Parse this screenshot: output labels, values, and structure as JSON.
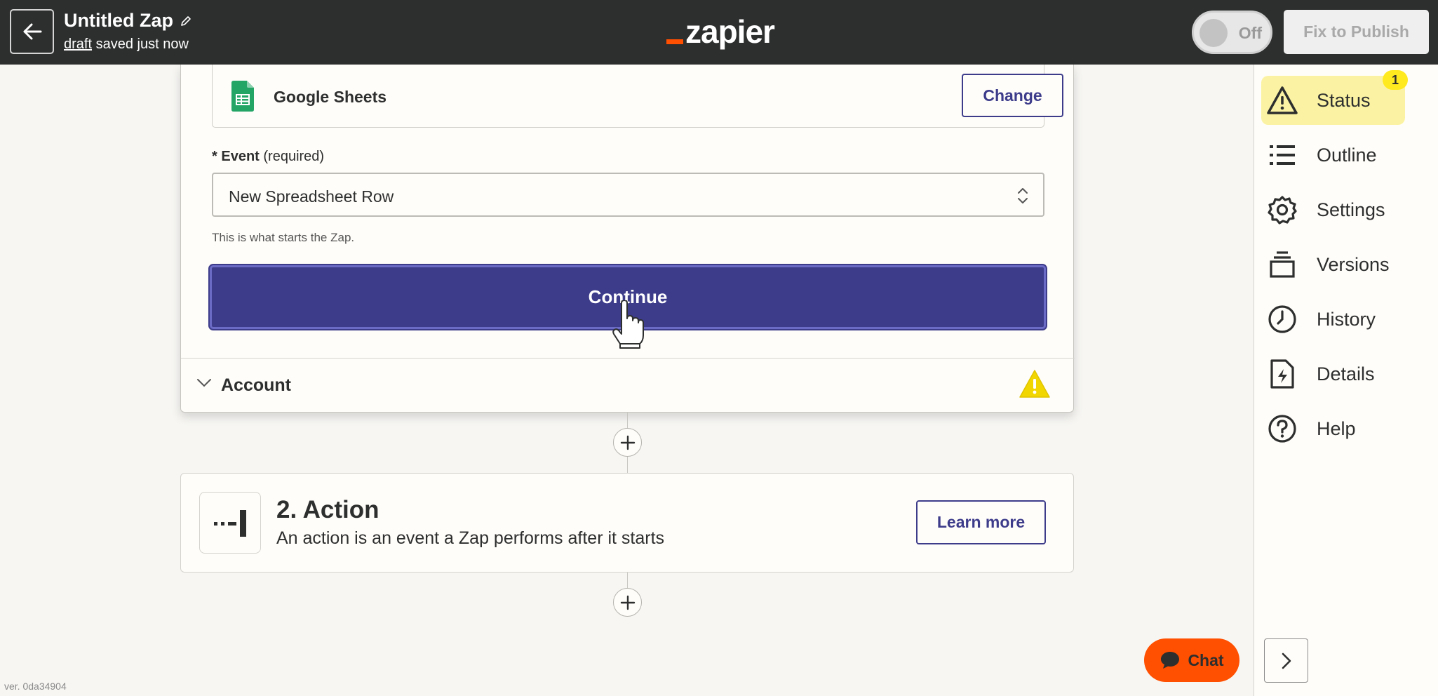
{
  "header": {
    "zap_title": "Untitled Zap",
    "status_draft": "draft",
    "status_saved": "saved just now",
    "logo_text": "zapier",
    "toggle_label": "Off",
    "publish_label": "Fix to Publish"
  },
  "trigger": {
    "app_name": "Google Sheets",
    "change_label": "Change",
    "event_required_mark": "*",
    "event_label": "Event",
    "event_required_text": "(required)",
    "event_value": "New Spreadsheet Row",
    "help_text": "This is what starts the Zap.",
    "continue_label": "Continue",
    "account_label": "Account"
  },
  "action": {
    "title": "2. Action",
    "description": "An action is an event a Zap performs after it starts",
    "learn_more_label": "Learn more"
  },
  "sidebar": {
    "items": [
      {
        "label": "Status",
        "icon": "warning-icon",
        "badge": "1"
      },
      {
        "label": "Outline",
        "icon": "list-icon"
      },
      {
        "label": "Settings",
        "icon": "gear-icon"
      },
      {
        "label": "Versions",
        "icon": "versions-icon"
      },
      {
        "label": "History",
        "icon": "clock-icon"
      },
      {
        "label": "Details",
        "icon": "file-bolt-icon"
      },
      {
        "label": "Help",
        "icon": "question-icon"
      }
    ]
  },
  "chat_label": "Chat",
  "version_text": "ver. 0da34904",
  "colors": {
    "brand_orange": "#ff4f00",
    "primary_purple": "#3d3c8b",
    "status_highlight": "#fbf3a3",
    "warning_yellow": "#ffe91f"
  }
}
